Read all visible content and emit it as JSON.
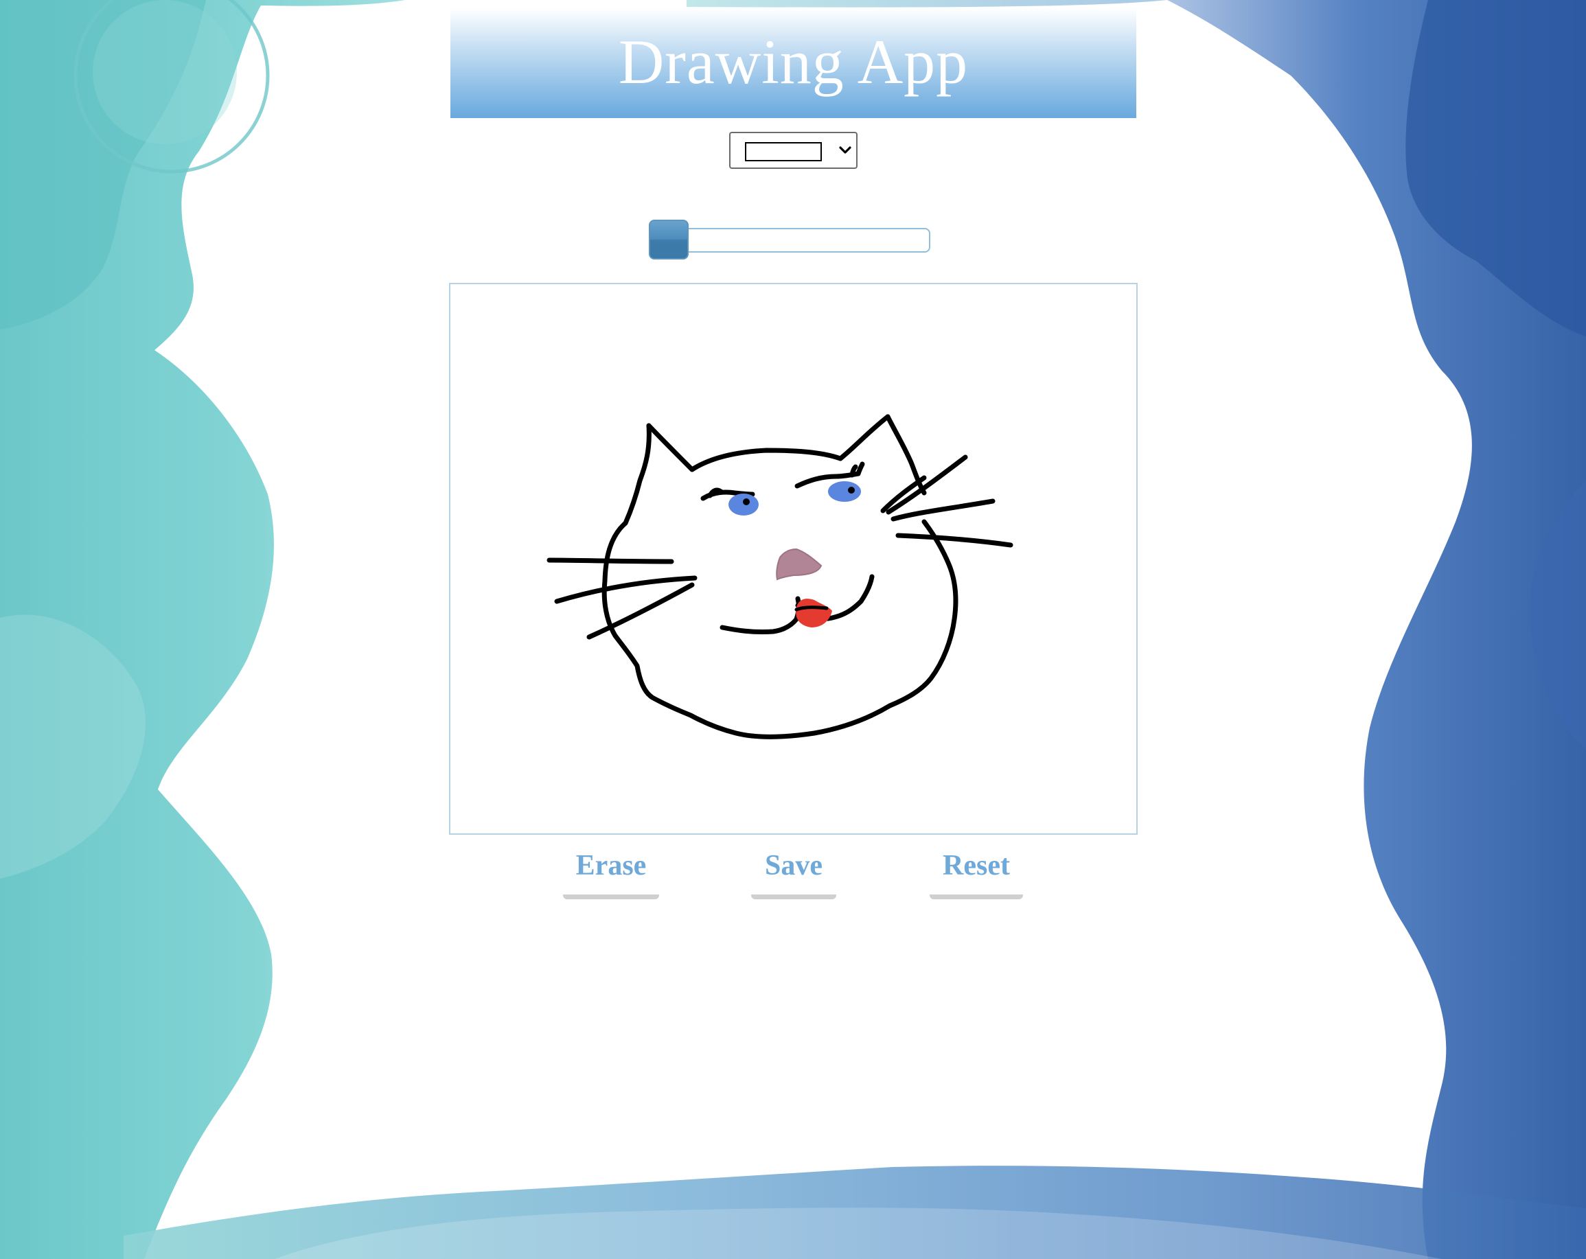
{
  "app": {
    "title": "Drawing App"
  },
  "controls": {
    "color_select": {
      "selected_color": "#ffffff",
      "swatch_border": "#000000"
    },
    "brush_size": {
      "value_fraction": 0.0
    }
  },
  "buttons": {
    "erase_label": "Erase",
    "save_label": "Save",
    "reset_label": "Reset"
  },
  "drawing": {
    "stroke_color": "#000000",
    "eye_color": "#5b86e0",
    "nose_color": "#b28596",
    "tongue_color": "#e53a30"
  },
  "theme": {
    "accent": "#6fa9d9",
    "header_gradient_bottom": "#6aa9de",
    "left_wash": "#6fcbcc",
    "right_wash": "#2f5ea8"
  }
}
